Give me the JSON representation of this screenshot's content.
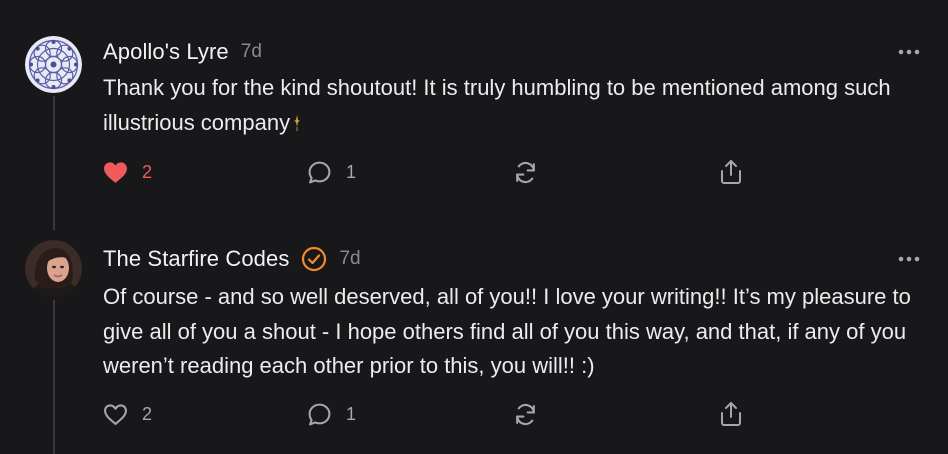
{
  "colors": {
    "background": "#18181a",
    "liked": "#f05a5a",
    "verified": "#f28a2e",
    "muted": "#8a8a90"
  },
  "comments": [
    {
      "author": "Apollo's Lyre",
      "time": "7d",
      "verified": false,
      "avatar": "mandala-avatar",
      "text": "Thank you for the kind shoutout! It is truly humbling to be mentioned among such illustrious company",
      "like_count": "2",
      "liked": true,
      "reply_count": "1"
    },
    {
      "author": "The Starfire Codes",
      "time": "7d",
      "verified": true,
      "avatar": "profile-photo-avatar",
      "text": "Of course - and so well deserved, all of you!! I love your writing!! It’s my pleasure to give all of you a shout - I hope others find all of you this way, and that, if any of you weren’t reading each other prior to this, you will!! :)",
      "like_count": "2",
      "liked": false,
      "reply_count": "1"
    }
  ]
}
